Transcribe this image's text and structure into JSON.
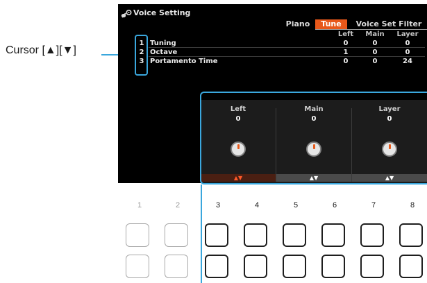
{
  "callout": {
    "cursor_label": "Cursor [▲][▼]"
  },
  "screen": {
    "title": "Voice Setting",
    "title_icon": "guitar-gear-icon",
    "tabs": [
      {
        "label": "Piano",
        "selected": false
      },
      {
        "label": "Tune",
        "selected": true
      },
      {
        "label": "Voice Set Filter",
        "selected": false
      }
    ],
    "columns": [
      "Left",
      "Main",
      "Layer"
    ],
    "rows": [
      {
        "num": "1",
        "name": "Tuning",
        "values": [
          "0",
          "0",
          "0"
        ]
      },
      {
        "num": "2",
        "name": "Octave",
        "values": [
          "1",
          "0",
          "0"
        ]
      },
      {
        "num": "3",
        "name": "Portamento Time",
        "values": [
          "0",
          "0",
          "24"
        ]
      }
    ],
    "knobs": [
      {
        "name": "Left",
        "value": "0",
        "arrows": "▲▼",
        "active": true
      },
      {
        "name": "Main",
        "value": "0",
        "arrows": "▲▼",
        "active": false
      },
      {
        "name": "Layer",
        "value": "0",
        "arrows": "▲▼",
        "active": false
      }
    ]
  },
  "buttons": {
    "numbers": [
      "1",
      "2",
      "3",
      "4",
      "5",
      "6",
      "7",
      "8"
    ]
  },
  "colors": {
    "accent_blue": "#3aa7dd",
    "tab_orange": "#e8581a",
    "screen_bg": "#000000"
  }
}
